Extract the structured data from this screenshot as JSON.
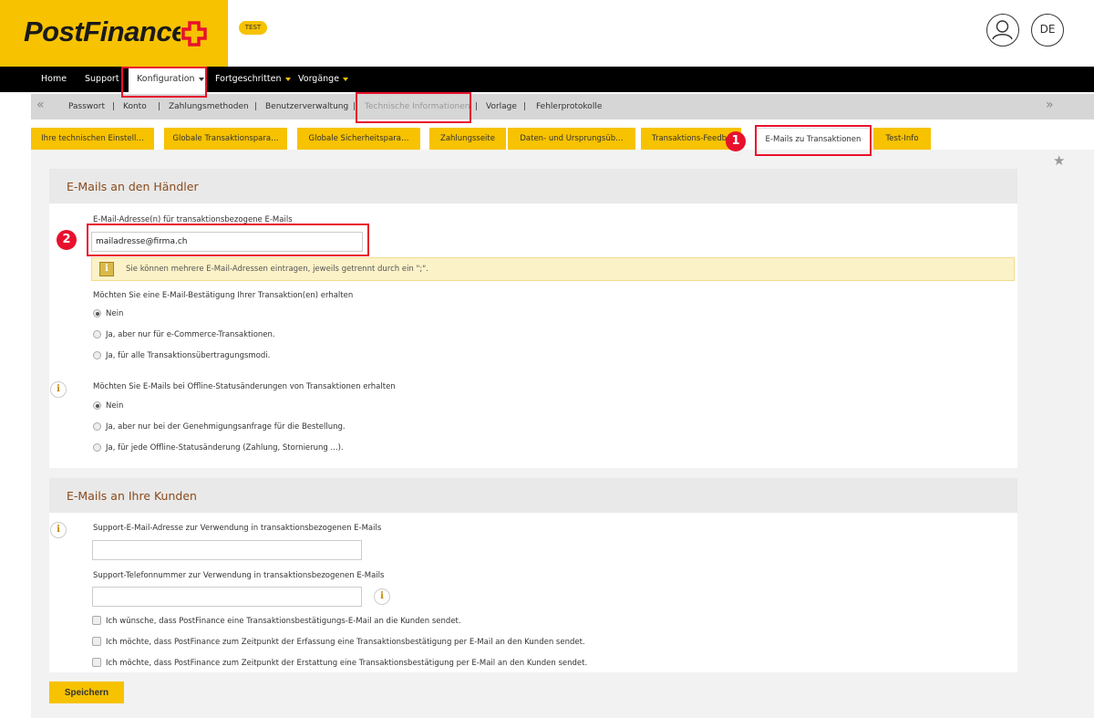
{
  "brand": {
    "logo_text": "PostFinance",
    "env_badge": "TEST",
    "accent_color": "#f7c200",
    "cross_color": "#e8112d"
  },
  "header": {
    "user_icon": "user-icon",
    "language": "DE"
  },
  "main_nav": [
    {
      "label": "Home"
    },
    {
      "label": "Support"
    },
    {
      "label": "Konfiguration"
    },
    {
      "label": "Fortgeschritten"
    },
    {
      "label": "Vorgänge"
    }
  ],
  "sub_nav": {
    "items": [
      "Passwort",
      "Konto",
      "Zahlungsmethoden",
      "Benutzerverwaltung",
      "Technische Informationen",
      "Vorlage",
      "Fehlerprotokolle"
    ],
    "separator": "|",
    "left_arrow": "«",
    "right_arrow": "»"
  },
  "tabs": [
    "Ihre technischen Einstell…",
    "Globale Transaktionspara…",
    "Globale Sicherheitspara…",
    "Zahlungsseite",
    "Daten- und Ursprungsüb…",
    "Transaktions-Feedback",
    "E-Mails zu Transaktionen",
    "Test-Info"
  ],
  "section_merchant": {
    "title": "E-Mails an den Händler",
    "email_label": "E-Mail-Adresse(n) für transaktionsbezogene E-Mails",
    "email_value": "mailadresse@firma.ch",
    "notice_icon_glyph": "i",
    "notice": "Sie können mehrere E-Mail-Adressen eintragen, jeweils getrennt durch ein \";\".",
    "confirm_question": "Möchten Sie eine E-Mail-Bestätigung Ihrer Transaktion(en) erhalten",
    "confirm_options": [
      "Nein",
      "Ja, aber nur für e-Commerce-Transaktionen.",
      "Ja, für alle Transaktionsübertragungsmodi."
    ],
    "info_glyph": "i",
    "offline_question": "Möchten Sie E-Mails bei Offline-Statusänderungen von Transaktionen erhalten",
    "offline_options": [
      "Nein",
      "Ja, aber nur bei der Genehmigungsanfrage für die Bestellung.",
      "Ja, für jede Offline-Statusänderung (Zahlung, Stornierung ...)."
    ]
  },
  "section_customers": {
    "title": "E-Mails an Ihre Kunden",
    "info_glyph": "i",
    "support_email_label": "Support-E-Mail-Adresse zur Verwendung in transaktionsbezogenen E-Mails",
    "support_email_value": "",
    "support_phone_label": "Support-Telefonnummer zur Verwendung in transaktionsbezogenen E-Mails",
    "support_phone_value": "",
    "checkboxes": [
      "Ich wünsche, dass PostFinance eine Transaktionsbestätigungs-E-Mail an die Kunden sendet.",
      "Ich möchte, dass PostFinance zum Zeitpunkt der Erfassung eine Transaktionsbestätigung per E-Mail an den Kunden sendet.",
      "Ich möchte, dass PostFinance zum Zeitpunkt der Erstattung eine Transaktionsbestätigung per E-Mail an den Kunden sendet."
    ]
  },
  "save_label": "Speichern",
  "markers": [
    "1",
    "2"
  ],
  "star_glyph": "★"
}
